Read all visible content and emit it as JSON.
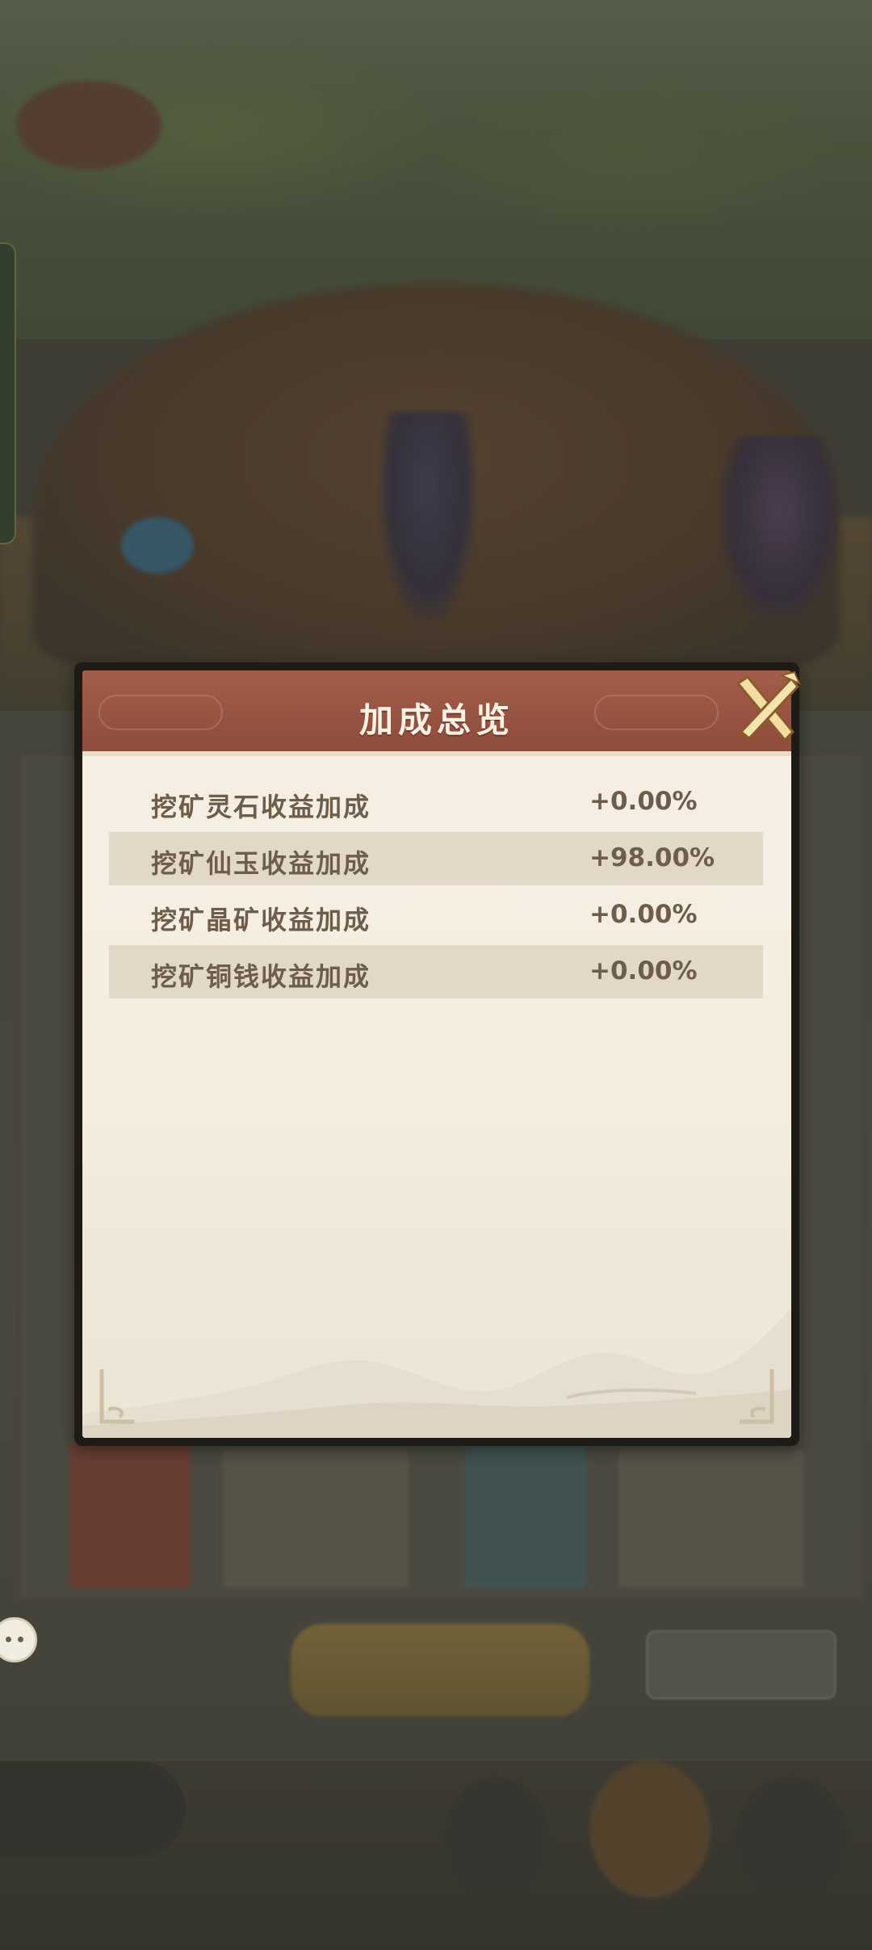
{
  "dialog": {
    "title": "加成总览",
    "close_icon": "close-x-icon",
    "rows": [
      {
        "name": "挖矿灵石收益加成",
        "value": "+0.00%"
      },
      {
        "name": "挖矿仙玉收益加成",
        "value": "+98.00%"
      },
      {
        "name": "挖矿晶矿收益加成",
        "value": "+0.00%"
      },
      {
        "name": "挖矿铜钱收益加成",
        "value": "+0.00%"
      }
    ]
  },
  "colors": {
    "header": "#a35d4a",
    "panel": "#f6efe3",
    "row_shade": "#e2d8c7",
    "text": "#6d5d4a",
    "close_icon": "#f2dca0"
  }
}
